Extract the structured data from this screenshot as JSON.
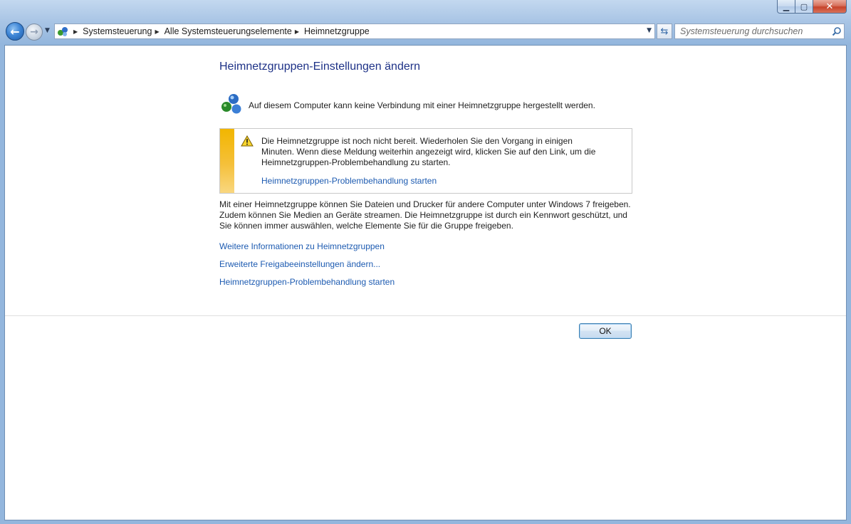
{
  "window": {
    "caption_buttons": {
      "minimize": "▁",
      "maximize": "▢",
      "close": "✕"
    }
  },
  "navigation": {
    "back_icon": "arrow-left-icon",
    "forward_icon": "arrow-right-icon",
    "breadcrumb": [
      "Systemsteuerung",
      "Alle Systemsteuerungselemente",
      "Heimnetzgruppe"
    ],
    "search_placeholder": "Systemsteuerung durchsuchen"
  },
  "main": {
    "title": "Heimnetzgruppen-Einstellungen ändern",
    "status_text": "Auf diesem Computer kann keine Verbindung mit einer Heimnetzgruppe hergestellt werden.",
    "warning": {
      "text": "Die Heimnetzgruppe ist noch nicht bereit. Wiederholen Sie den Vorgang in einigen Minuten. Wenn diese Meldung weiterhin angezeigt wird, klicken Sie auf den Link, um die Heimnetzgruppen-Problembehandlung zu starten.",
      "link": "Heimnetzgruppen-Problembehandlung starten",
      "accent_color": "#f2b600"
    },
    "description": "Mit einer Heimnetzgruppe können Sie Dateien und Drucker für andere Computer unter Windows 7 freigeben. Zudem können Sie Medien an Geräte streamen. Die Heimnetzgruppe ist durch ein Kennwort geschützt, und Sie können immer auswählen, welche Elemente Sie für die Gruppe freigeben.",
    "links": [
      "Weitere Informationen zu Heimnetzgruppen",
      "Erweiterte Freigabeeinstellungen ändern...",
      "Heimnetzgruppen-Problembehandlung starten"
    ],
    "ok_label": "OK",
    "link_color": "#1d5bb1",
    "title_color": "#1e3287"
  }
}
